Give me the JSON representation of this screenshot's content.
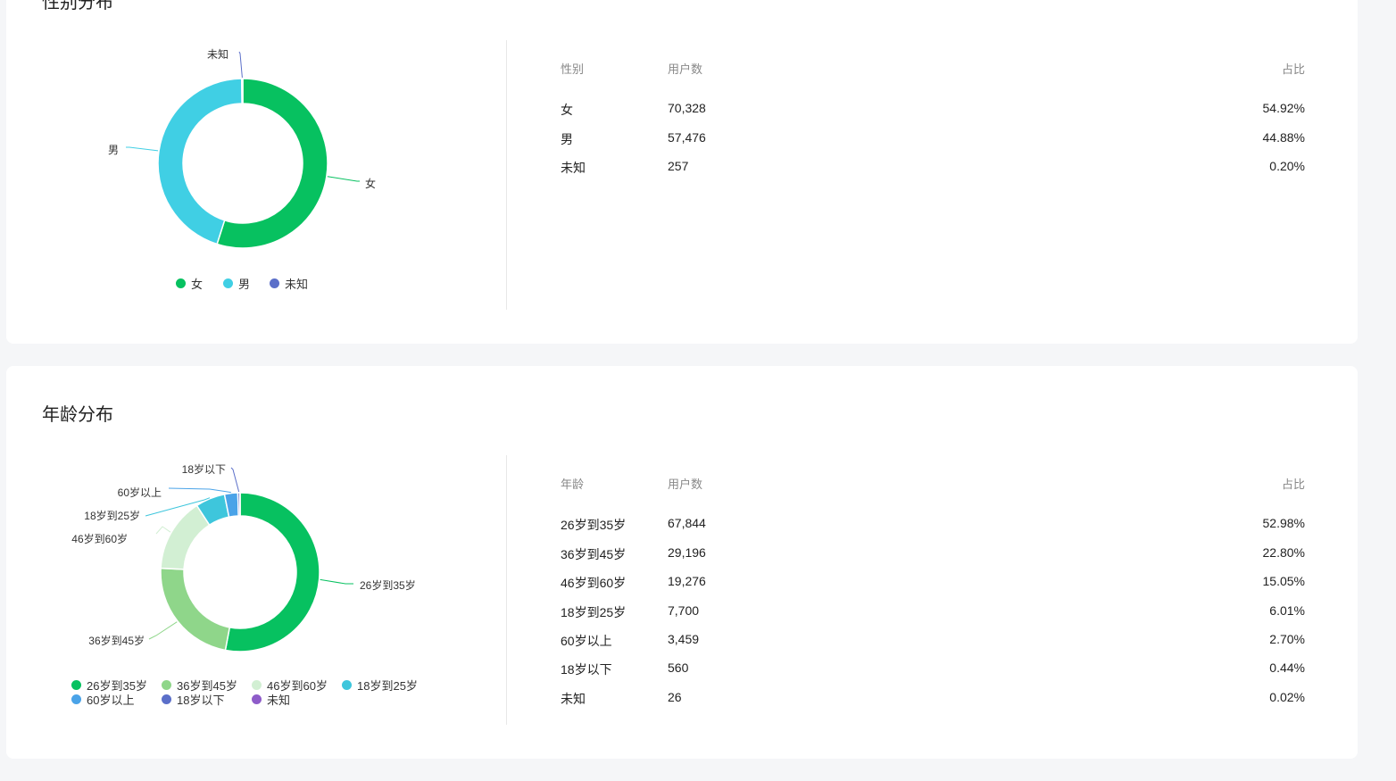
{
  "gender_section": {
    "title": "性别分布",
    "table_headers": {
      "category": "性别",
      "users": "用户数",
      "ratio": "占比"
    },
    "rows": [
      {
        "label": "女",
        "users": "70,328",
        "ratio": "54.92%"
      },
      {
        "label": "男",
        "users": "57,476",
        "ratio": "44.88%"
      },
      {
        "label": "未知",
        "users": "257",
        "ratio": "0.20%"
      }
    ]
  },
  "age_section": {
    "title": "年龄分布",
    "table_headers": {
      "category": "年龄",
      "users": "用户数",
      "ratio": "占比"
    },
    "rows": [
      {
        "label": "26岁到35岁",
        "users": "67,844",
        "ratio": "52.98%"
      },
      {
        "label": "36岁到45岁",
        "users": "29,196",
        "ratio": "22.80%"
      },
      {
        "label": "46岁到60岁",
        "users": "19,276",
        "ratio": "15.05%"
      },
      {
        "label": "18岁到25岁",
        "users": "7,700",
        "ratio": "6.01%"
      },
      {
        "label": "60岁以上",
        "users": "3,459",
        "ratio": "2.70%"
      },
      {
        "label": "18岁以下",
        "users": "560",
        "ratio": "0.44%"
      },
      {
        "label": "未知",
        "users": "26",
        "ratio": "0.02%"
      }
    ]
  },
  "chart_data": [
    {
      "type": "pie",
      "style": "donut",
      "title": "性别分布",
      "categories": [
        "女",
        "男",
        "未知"
      ],
      "values": [
        70328,
        57476,
        257
      ],
      "colors": [
        "#07c160",
        "#40cfe4",
        "#5b6fc9"
      ],
      "legend": [
        "女",
        "男",
        "未知"
      ],
      "legend_position": "bottom"
    },
    {
      "type": "pie",
      "style": "donut",
      "title": "年龄分布",
      "categories": [
        "26岁到35岁",
        "36岁到45岁",
        "46岁到60岁",
        "18岁到25岁",
        "60岁以上",
        "18岁以下",
        "未知"
      ],
      "values": [
        67844,
        29196,
        19276,
        7700,
        3459,
        560,
        26
      ],
      "colors": [
        "#07c160",
        "#8fd68a",
        "#d2efd3",
        "#3ec6dc",
        "#4aa3e8",
        "#5b6fc9",
        "#8e5cc9"
      ],
      "legend": [
        "26岁到35岁",
        "36岁到45岁",
        "46岁到60岁",
        "18岁到25岁",
        "60岁以上",
        "18岁以下",
        "未知"
      ],
      "legend_position": "bottom"
    }
  ]
}
